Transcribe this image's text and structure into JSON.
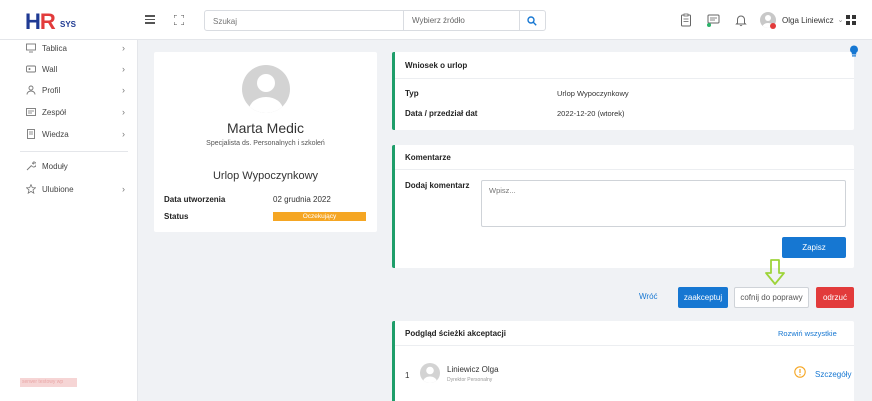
{
  "header": {
    "logo_text": "HR",
    "logo_sub": "SYS",
    "search_placeholder": "Szukaj",
    "source_label": "Wybierz źródło",
    "user_name": "Olga Liniewicz"
  },
  "sidebar": {
    "items": [
      {
        "label": "Tablica",
        "icon": "monitor-icon",
        "arrow": "›"
      },
      {
        "label": "Wall",
        "icon": "wall-icon",
        "arrow": "›"
      },
      {
        "label": "Profil",
        "icon": "user-icon",
        "arrow": "›"
      },
      {
        "label": "Zespół",
        "icon": "team-icon",
        "arrow": "›"
      },
      {
        "label": "Wiedza",
        "icon": "book-icon",
        "arrow": "›"
      },
      {
        "label": "Moduły",
        "icon": "wrench-icon",
        "arrow": ""
      },
      {
        "label": "Ulubione",
        "icon": "star-icon",
        "arrow": "›"
      }
    ],
    "watermark": "serwer testowy wp"
  },
  "profile": {
    "name": "Marta Medic",
    "role": "Specjalista ds. Personalnych i szkoleń",
    "request_type": "Urlop Wypoczynkowy",
    "created_label": "Data utworzenia",
    "created_value": "02 grudnia 2022",
    "status_label": "Status",
    "status_value": "Oczekujący",
    "status_color": "#f5a623"
  },
  "request": {
    "title": "Wniosek o urlop",
    "type_label": "Typ",
    "type_value": "Urlop Wypoczynkowy",
    "date_label": "Data / przedział dat",
    "date_value": "2022-12-20 (wtorek)"
  },
  "comments": {
    "title": "Komentarze",
    "add_label": "Dodaj komentarz",
    "placeholder": "Wpisz...",
    "save_label": "Zapisz"
  },
  "actions": {
    "back_label": "Wróć",
    "accept_label": "zaakceptuj",
    "return_label": "cofnij do poprawy",
    "reject_label": "odrzuć"
  },
  "path": {
    "title": "Podgląd ścieżki akceptacji",
    "expand_label": "Rozwiń wszystkie",
    "steps": [
      {
        "number": "1",
        "name": "Liniewicz Olga",
        "role": "Dyrektor Personalny",
        "details_label": "Szczegóły"
      }
    ]
  },
  "colors": {
    "accent_blue": "#1677d2",
    "accent_green": "#1e9e6a",
    "danger": "#e23b3b",
    "warning": "#f5a623"
  }
}
